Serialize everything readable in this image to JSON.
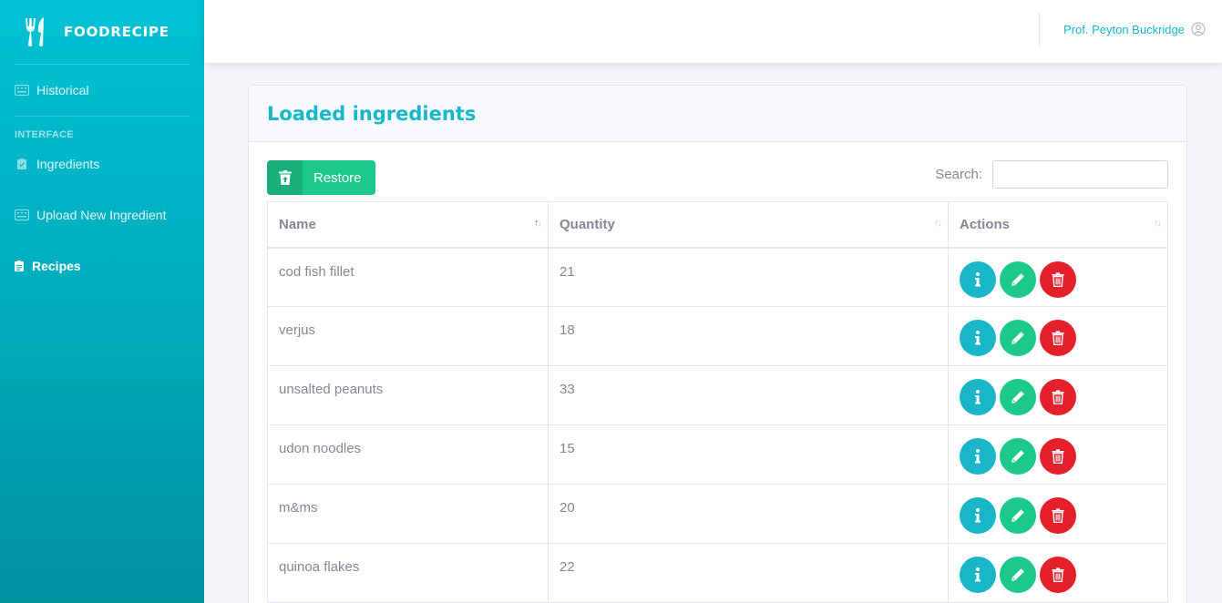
{
  "brand": {
    "name": "FOODRECIPE"
  },
  "sidebar": {
    "items": [
      {
        "label": "Historical",
        "icon": "keyboard-icon"
      },
      {
        "heading": "INTERFACE"
      },
      {
        "label": "Ingredients",
        "icon": "clipboard-check-icon"
      },
      {
        "label": "Upload New Ingredient",
        "icon": "keyboard-icon"
      },
      {
        "label": "Recipes",
        "icon": "clipboard-list-icon",
        "active": true
      }
    ]
  },
  "topbar": {
    "user_name": "Prof. Peyton Buckridge"
  },
  "card": {
    "title": "Loaded ingredients",
    "restore_label": "Restore",
    "search_label": "Search:",
    "search_value": ""
  },
  "table": {
    "headers": [
      "Name",
      "Quantity",
      "Actions"
    ],
    "rows": [
      {
        "name": "cod fish fillet",
        "quantity": "21"
      },
      {
        "name": "verjus",
        "quantity": "18"
      },
      {
        "name": "unsalted peanuts",
        "quantity": "33"
      },
      {
        "name": "udon noodles",
        "quantity": "15"
      },
      {
        "name": "m&ms",
        "quantity": "20"
      },
      {
        "name": "quinoa flakes",
        "quantity": "22"
      }
    ]
  },
  "colors": {
    "primary": "#1ab5c6",
    "success": "#1cc88a",
    "danger": "#e4202b"
  }
}
